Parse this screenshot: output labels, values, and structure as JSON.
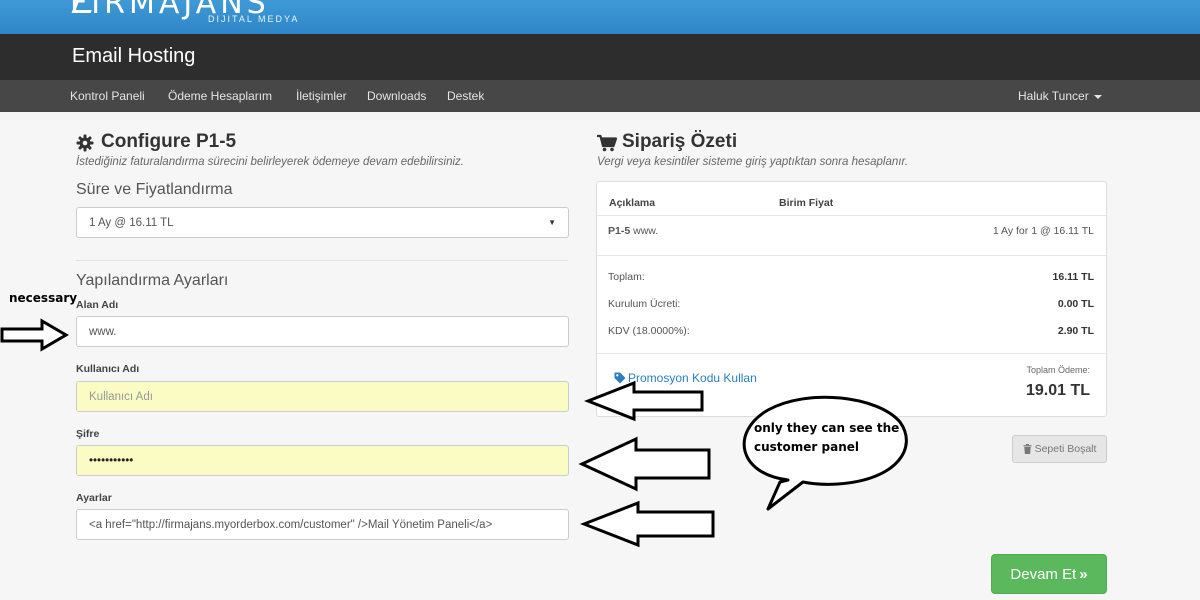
{
  "logo": {
    "name": "FIRMAJANS",
    "tagline": "DIJITAL MEDYA"
  },
  "header": {
    "title": "Email Hosting"
  },
  "nav": {
    "items": [
      "Kontrol Paneli",
      "Ödeme Hesaplarım",
      "İletişimler",
      "Downloads",
      "Destek"
    ],
    "user": "Haluk Tuncer"
  },
  "configure": {
    "title": "Configure P1-5",
    "subtitle": "İstediğiniz faturalandırma sürecini belirleyerek ödemeye devam edebilirsiniz.",
    "billing_section": "Süre ve Fiyatlandırma",
    "billing_selected": "1 Ay @ 16.11 TL",
    "config_section": "Yapılandırma Ayarları",
    "fields": [
      {
        "label": "Alan Adı",
        "value": "www."
      },
      {
        "label": "Kullanıcı Adı",
        "placeholder": "Kullanıcı Adı"
      },
      {
        "label": "Şifre",
        "value": "•••••••••••"
      },
      {
        "label": "Ayarlar",
        "value": "<a href=\"http://firmajans.myorderbox.com/customer\" />Mail Yönetim Paneli</a>"
      }
    ]
  },
  "summary": {
    "title": "Sipariş Özeti",
    "subtitle": "Vergi veya kesintiler sisteme giriş yaptıktan sonra hesaplanır.",
    "col_desc": "Açıklama",
    "col_price": "Birim Fiyat",
    "item_name": "P1-5",
    "item_domain": "www.",
    "item_price": "1 Ay for 1 @ 16.11 TL",
    "rows": [
      {
        "label": "Toplam:",
        "value": "16.11 TL"
      },
      {
        "label": "Kurulum Ücreti:",
        "value": "0.00 TL"
      },
      {
        "label": "KDV (18.0000%):",
        "value": "2.90 TL"
      }
    ],
    "promo": "Promosyon Kodu Kullan",
    "total_label": "Toplam Ödeme:",
    "total_value": "19.01 TL",
    "empty_cart": "Sepeti Boşalt",
    "continue": "Devam Et"
  },
  "annotations": {
    "necessary": "necessary",
    "bubble_line1": "only they can see the",
    "bubble_line2": "customer panel"
  },
  "colors": {
    "brand_blue": "#3f9ad7",
    "header": "#2d2d2d",
    "nav": "#474747",
    "continue_green": "#5cb85c",
    "autofill_yellow": "#fafcc3"
  },
  "icons": [
    "gear-icon",
    "cart-icon",
    "tag-icon",
    "trash-icon",
    "chevron-right-icon",
    "caret-down-icon"
  ]
}
